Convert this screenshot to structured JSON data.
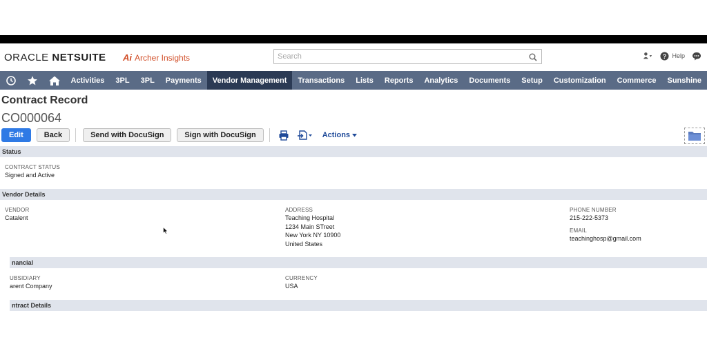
{
  "header": {
    "logo_oracle": "ORACLE",
    "logo_netsuite": "NETSUITE",
    "archer_mark": "Ai",
    "archer_text": "Archer Insights",
    "search_placeholder": "Search",
    "help_label": "Help"
  },
  "nav": {
    "items": [
      "Activities",
      "3PL",
      "3PL",
      "Payments",
      "Vendor Management",
      "Transactions",
      "Lists",
      "Reports",
      "Analytics",
      "Documents",
      "Setup",
      "Customization",
      "Commerce",
      "Sunshine"
    ],
    "active_index": 4
  },
  "page": {
    "title": "Contract Record",
    "record_id": "CO000064"
  },
  "toolbar": {
    "edit": "Edit",
    "back": "Back",
    "send_docusign": "Send with DocuSign",
    "sign_docusign": "Sign with DocuSign",
    "actions": "Actions"
  },
  "sections": {
    "status": {
      "title": "Status",
      "contract_status_label": "CONTRACT STATUS",
      "contract_status_value": "Signed and Active"
    },
    "vendor": {
      "title": "Vendor Details",
      "vendor_label": "VENDOR",
      "vendor_value": "Catalent",
      "address_label": "ADDRESS",
      "address_lines": [
        "Teaching Hospital",
        "1234 Main STreet",
        "New York NY 10900",
        "United States"
      ],
      "phone_label": "PHONE NUMBER",
      "phone_value": "215-222-5373",
      "email_label": "EMAIL",
      "email_value": "teachinghosp@gmail.com"
    },
    "financial": {
      "title": "nancial",
      "subsidiary_label": "UBSIDIARY",
      "subsidiary_value": "arent Company",
      "currency_label": "CURRENCY",
      "currency_value": "USA"
    },
    "contract": {
      "title": "ntract Details"
    }
  },
  "colors": {
    "nav_bg": "#5a6b86",
    "nav_active": "#2b3a54",
    "primary": "#2f7ae5",
    "section_bg": "#e0e4ec",
    "archer": "#d2502a"
  }
}
